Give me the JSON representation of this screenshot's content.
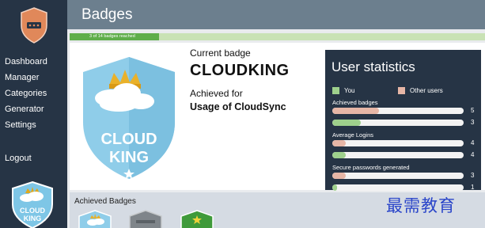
{
  "sidebar": {
    "logo_icon": "shield-logo-icon",
    "items": [
      {
        "label": "Dashboard"
      },
      {
        "label": "Manager"
      },
      {
        "label": "Categories"
      },
      {
        "label": "Generator"
      },
      {
        "label": "Settings"
      }
    ],
    "logout": "Logout",
    "badge_text_top": "CLOUD",
    "badge_text_bottom": "KING"
  },
  "header": {
    "title": "Badges"
  },
  "progress": {
    "text": "3 of 14 badges reached",
    "achieved": 3,
    "total": 14
  },
  "current_badge": {
    "caption": "Current badge",
    "name": "CLOUDKING",
    "achieved_for_label": "Achieved for",
    "achieved_for": "Usage of CloudSync",
    "badge_text_top": "CLOUD",
    "badge_text_bottom": "KING"
  },
  "stats": {
    "title": "User statistics",
    "legend": {
      "you": "You",
      "others": "Other users"
    },
    "colors": {
      "you": "#9ed08c",
      "others": "#e6b6a6"
    },
    "groups": [
      {
        "label": "Achieved badges",
        "others": 5,
        "you": 3,
        "max": 14
      },
      {
        "label": "Average Logins",
        "others": 4,
        "you": 4,
        "max": 40
      },
      {
        "label": "Secure passwords generated",
        "others": 3,
        "you": 1,
        "max": 30
      }
    ]
  },
  "achieved": {
    "title": "Achieved Badges"
  },
  "watermark": "最需教育"
}
